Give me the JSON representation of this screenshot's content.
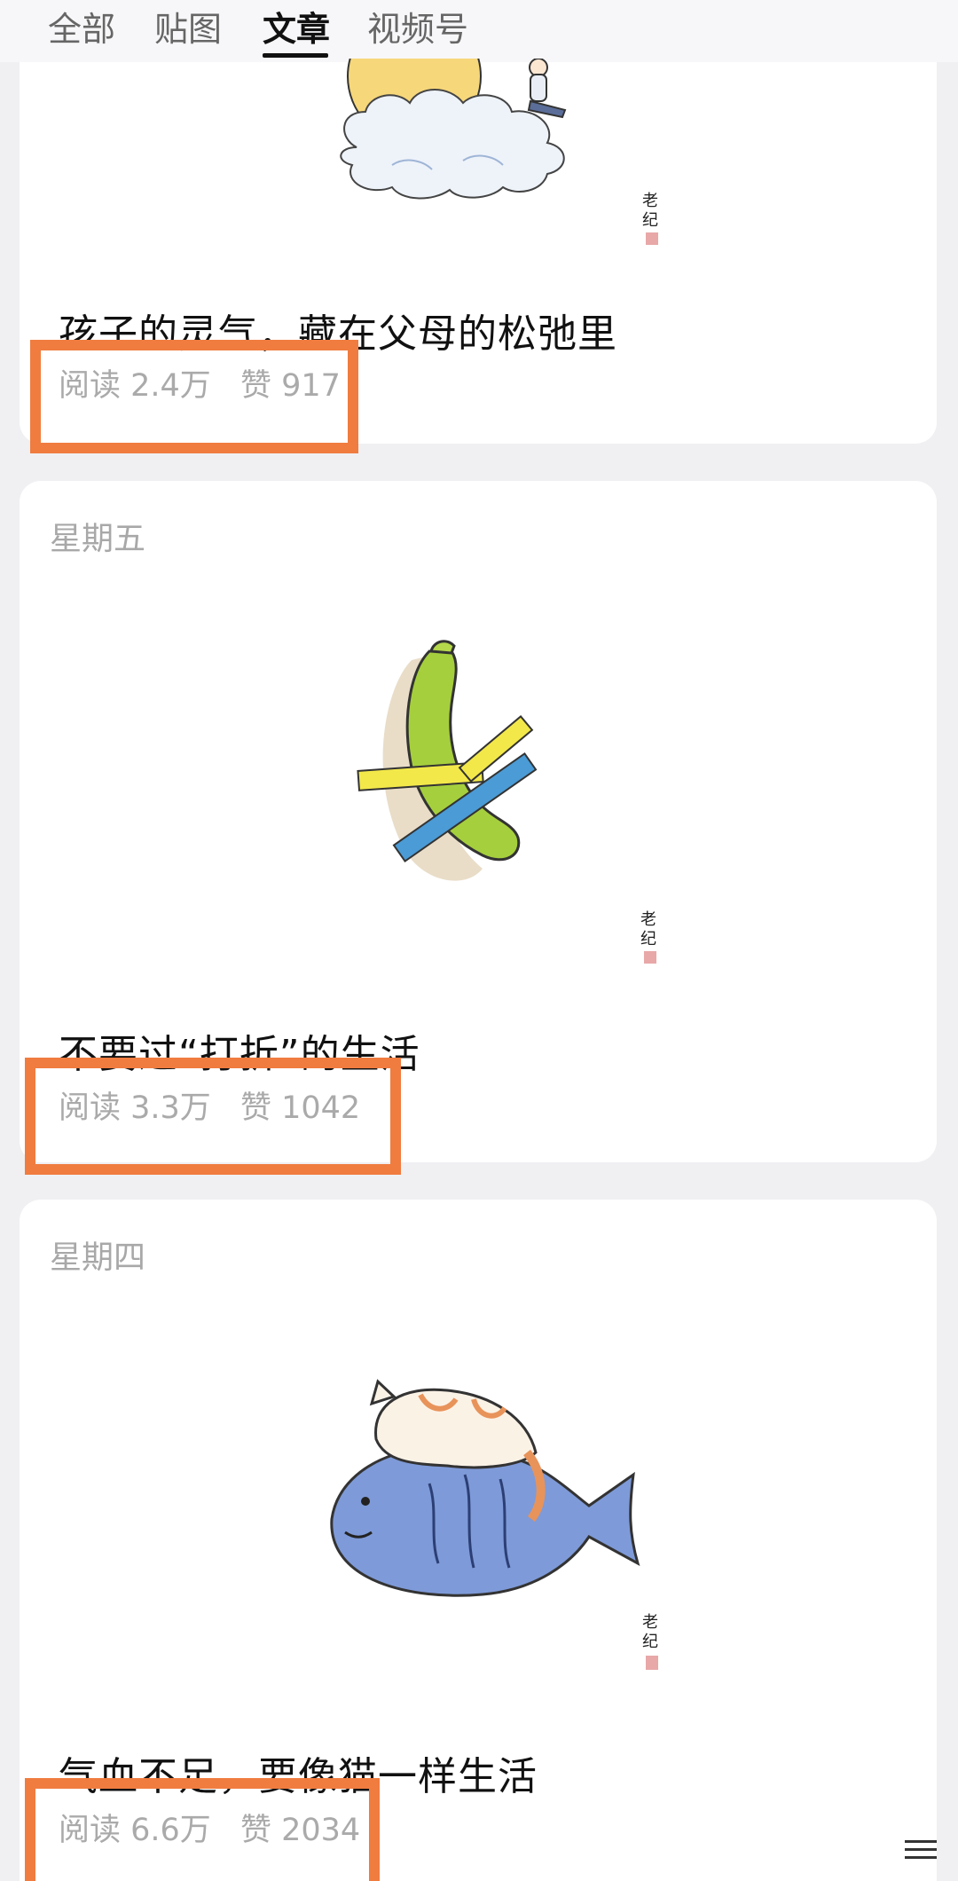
{
  "tabs": [
    {
      "label": "全部",
      "active": false
    },
    {
      "label": "贴图",
      "active": false
    },
    {
      "label": "文章",
      "active": true
    },
    {
      "label": "视频号",
      "active": false
    }
  ],
  "articles": [
    {
      "day": "",
      "title": "孩子的灵气，藏在父母的松弛里",
      "reads": "阅读 2.4万",
      "likes": "赞 917",
      "illustration": "moon-and-cloud-boy"
    },
    {
      "day": "星期五",
      "title": "不要过“打折”的生活",
      "reads": "阅读 3.3万",
      "likes": "赞 1042",
      "illustration": "taped-cucumber"
    },
    {
      "day": "星期四",
      "title": "气血不足，要像猫一样生活",
      "reads": "阅读 6.6万",
      "likes": "赞 2034",
      "illustration": "cat-on-fish"
    }
  ],
  "signature_text": "老纪",
  "colors": {
    "highlight": "#f07c3f",
    "background": "#f0f0f3",
    "stats_text": "#aaaaaa"
  }
}
